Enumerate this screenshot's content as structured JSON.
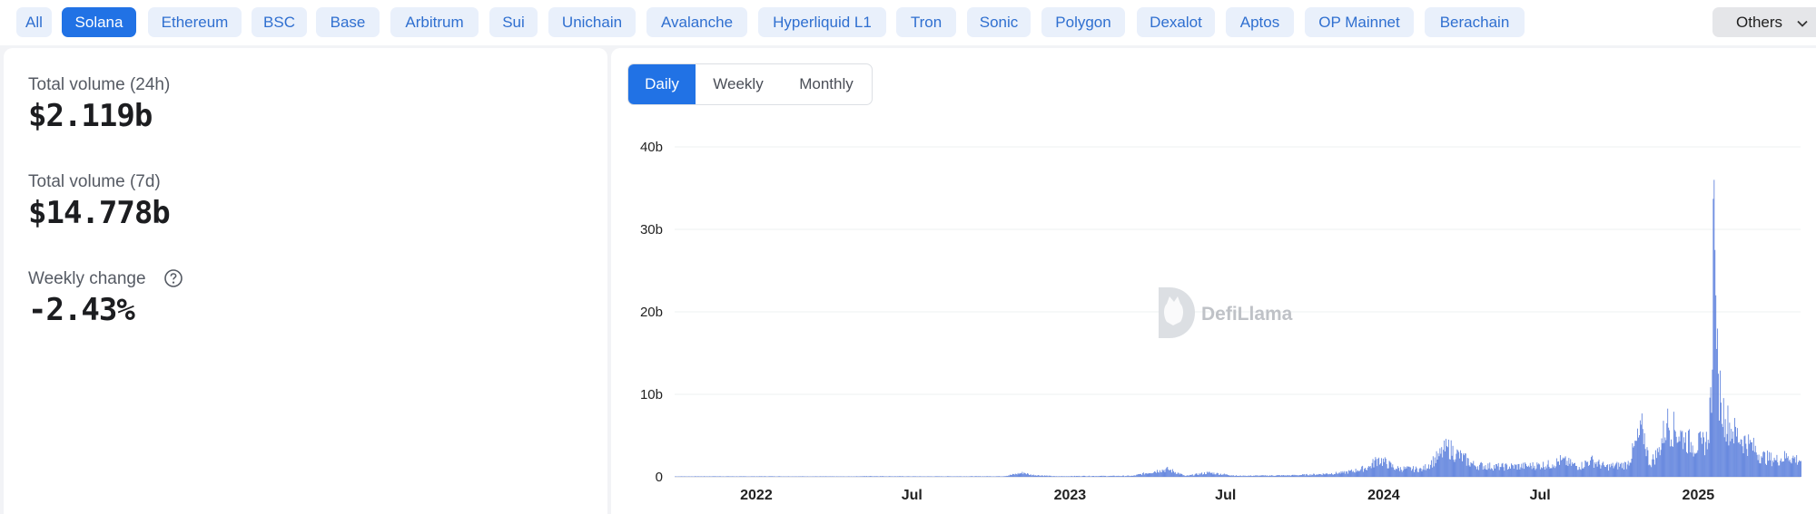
{
  "chains": [
    {
      "label": "All"
    },
    {
      "label": "Solana"
    },
    {
      "label": "Ethereum"
    },
    {
      "label": "BSC"
    },
    {
      "label": "Base"
    },
    {
      "label": "Arbitrum"
    },
    {
      "label": "Sui"
    },
    {
      "label": "Unichain"
    },
    {
      "label": "Avalanche"
    },
    {
      "label": "Hyperliquid L1"
    },
    {
      "label": "Tron"
    },
    {
      "label": "Sonic"
    },
    {
      "label": "Polygon"
    },
    {
      "label": "Dexalot"
    },
    {
      "label": "Aptos"
    },
    {
      "label": "OP Mainnet"
    },
    {
      "label": "Berachain"
    }
  ],
  "selected_chain": "Solana",
  "others_label": "Others",
  "stats": {
    "volume_24h_label": "Total volume (24h)",
    "volume_24h_value": "$2.119b",
    "volume_7d_label": "Total volume (7d)",
    "volume_7d_value": "$14.778b",
    "weekly_change_label": "Weekly change",
    "weekly_change_value": "-2.43%"
  },
  "period_tabs": [
    {
      "label": "Daily"
    },
    {
      "label": "Weekly"
    },
    {
      "label": "Monthly"
    }
  ],
  "selected_period": "Daily",
  "watermark": "DefiLlama",
  "colors": {
    "accent": "#2172e5",
    "pill_bg": "#e9f0fb",
    "pill_text": "#2f6fd0",
    "bar": "#5b7fdc"
  },
  "chart_data": {
    "type": "bar",
    "y_ticks": [
      "0",
      "10b",
      "20b",
      "30b",
      "40b"
    ],
    "x_ticks": [
      {
        "label": "2022",
        "date": "2022-01-01",
        "bold": true
      },
      {
        "label": "Jul",
        "date": "2022-07-01",
        "bold": false
      },
      {
        "label": "2023",
        "date": "2023-01-01",
        "bold": true
      },
      {
        "label": "Jul",
        "date": "2023-07-01",
        "bold": false
      },
      {
        "label": "2024",
        "date": "2024-01-01",
        "bold": true
      },
      {
        "label": "Jul",
        "date": "2024-07-01",
        "bold": false
      },
      {
        "label": "2025",
        "date": "2025-01-01",
        "bold": true
      }
    ],
    "x_range": [
      "2021-09-28",
      "2025-04-30"
    ],
    "ylim": [
      0,
      40
    ],
    "y_unit": "b",
    "grid": true,
    "series": [
      {
        "values": [
          [
            "2021-10-15",
            0.05
          ],
          [
            "2021-11-15",
            0.06
          ],
          [
            "2021-12-15",
            0.05
          ],
          [
            "2022-01-15",
            0.06
          ],
          [
            "2022-02-15",
            0.05
          ],
          [
            "2022-03-15",
            0.05
          ],
          [
            "2022-04-15",
            0.04
          ],
          [
            "2022-05-15",
            0.08
          ],
          [
            "2022-06-15",
            0.06
          ],
          [
            "2022-07-15",
            0.05
          ],
          [
            "2022-08-15",
            0.06
          ],
          [
            "2022-09-15",
            0.06
          ],
          [
            "2022-10-15",
            0.07
          ],
          [
            "2022-11-08",
            0.5
          ],
          [
            "2022-11-15",
            0.25
          ],
          [
            "2022-12-15",
            0.06
          ],
          [
            "2023-01-15",
            0.1
          ],
          [
            "2023-02-15",
            0.1
          ],
          [
            "2023-03-15",
            0.12
          ],
          [
            "2023-04-15",
            0.8
          ],
          [
            "2023-04-25",
            0.9
          ],
          [
            "2023-05-15",
            0.1
          ],
          [
            "2023-06-10",
            0.5
          ],
          [
            "2023-06-20",
            0.4
          ],
          [
            "2023-07-15",
            0.12
          ],
          [
            "2023-08-15",
            0.15
          ],
          [
            "2023-09-15",
            0.18
          ],
          [
            "2023-10-15",
            0.3
          ],
          [
            "2023-11-15",
            0.5
          ],
          [
            "2023-12-01",
            0.8
          ],
          [
            "2023-12-15",
            1.2
          ],
          [
            "2023-12-25",
            2.2
          ],
          [
            "2024-01-15",
            1.0
          ],
          [
            "2024-02-15",
            0.9
          ],
          [
            "2024-03-05",
            2.5
          ],
          [
            "2024-03-15",
            3.6
          ],
          [
            "2024-03-25",
            2.8
          ],
          [
            "2024-04-15",
            1.4
          ],
          [
            "2024-05-15",
            1.2
          ],
          [
            "2024-06-15",
            1.3
          ],
          [
            "2024-07-15",
            1.5
          ],
          [
            "2024-07-25",
            2.0
          ],
          [
            "2024-08-15",
            1.2
          ],
          [
            "2024-08-28",
            2.0
          ],
          [
            "2024-09-15",
            1.2
          ],
          [
            "2024-10-10",
            1.5
          ],
          [
            "2024-10-28",
            5.8
          ],
          [
            "2024-11-05",
            1.5
          ],
          [
            "2024-11-15",
            3.0
          ],
          [
            "2024-11-25",
            6.5
          ],
          [
            "2024-12-05",
            5.5
          ],
          [
            "2024-12-15",
            4.8
          ],
          [
            "2024-12-25",
            3.8
          ],
          [
            "2025-01-05",
            4.0
          ],
          [
            "2025-01-12",
            4.5
          ],
          [
            "2025-01-17",
            13.0
          ],
          [
            "2025-01-19",
            36.0
          ],
          [
            "2025-01-20",
            27.5
          ],
          [
            "2025-01-21",
            22.0
          ],
          [
            "2025-01-22",
            15.5
          ],
          [
            "2025-01-24",
            12.5
          ],
          [
            "2025-01-27",
            9.0
          ],
          [
            "2025-02-01",
            7.0
          ],
          [
            "2025-02-10",
            5.5
          ],
          [
            "2025-02-20",
            4.5
          ],
          [
            "2025-03-01",
            4.0
          ],
          [
            "2025-03-15",
            2.5
          ],
          [
            "2025-04-01",
            2.0
          ],
          [
            "2025-04-15",
            2.5
          ],
          [
            "2025-04-28",
            2.0
          ]
        ]
      }
    ]
  }
}
